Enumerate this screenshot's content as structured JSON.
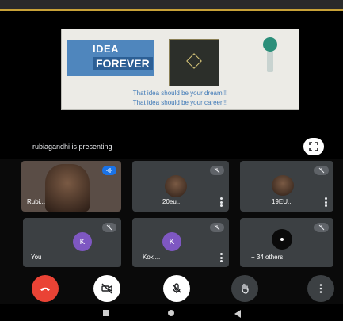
{
  "presentation": {
    "slide_title_1": "IDEA",
    "slide_title_2": "FOREVER",
    "slide_line_1": "That idea should be your dream!!!",
    "slide_line_2": "That idea should be your career!!!",
    "presenter_text": "rubiagandhi is presenting"
  },
  "participants": [
    {
      "name": "Rubi...",
      "kind": "photo"
    },
    {
      "name": "20eu...",
      "kind": "photo"
    },
    {
      "name": "19EU...",
      "kind": "photo"
    },
    {
      "name": "You",
      "kind": "letter",
      "letter": "K"
    },
    {
      "name": "Koki...",
      "kind": "letter",
      "letter": "K"
    },
    {
      "name": "+ 34 others",
      "kind": "others"
    }
  ],
  "colors": {
    "end_call": "#ea4335",
    "tile_bg": "#3c4043",
    "avatar": "#7e57c2",
    "accent_bar": "#c8a238"
  },
  "icons": {
    "end_call": "end-call-icon",
    "camera": "camera-off-icon",
    "mic": "mic-off-icon",
    "hand": "raise-hand-icon",
    "more": "more-vert-icon",
    "fullscreen": "fullscreen-icon"
  }
}
